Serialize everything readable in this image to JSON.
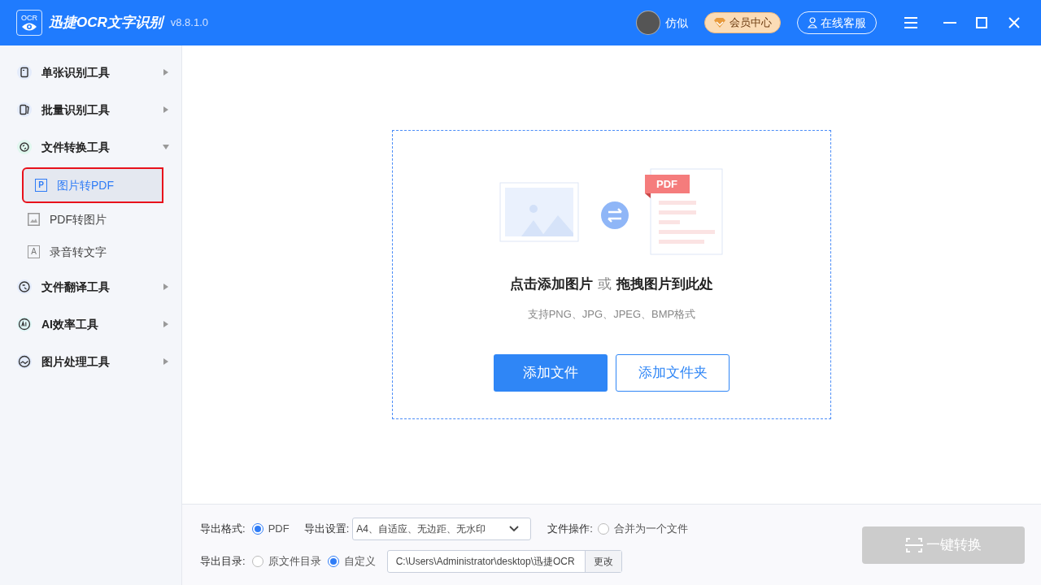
{
  "app": {
    "logo_text": "OCR",
    "title": "迅捷OCR文字识别",
    "version": "v8.8.1.0"
  },
  "header": {
    "username": "仿似",
    "vip_label": "会员中心",
    "service_label": "在线客服"
  },
  "sidebar": {
    "groups": [
      {
        "label": "单张识别工具",
        "kind": "single",
        "expanded": false
      },
      {
        "label": "批量识别工具",
        "kind": "batch",
        "expanded": false
      },
      {
        "label": "文件转换工具",
        "kind": "convert",
        "expanded": true,
        "children": [
          {
            "label": "图片转PDF",
            "icon": "P",
            "kind": "letter",
            "selected": true
          },
          {
            "label": "PDF转图片",
            "kind": "image",
            "selected": false
          },
          {
            "label": "录音转文字",
            "icon": "A",
            "kind": "letter",
            "selected": false
          }
        ]
      },
      {
        "label": "文件翻译工具",
        "kind": "translate",
        "expanded": false
      },
      {
        "label": "AI效率工具",
        "kind": "ai",
        "expanded": false
      },
      {
        "label": "图片处理工具",
        "kind": "picture",
        "expanded": false
      }
    ]
  },
  "drop_zone": {
    "pdf_tag": "PDF",
    "title_a": "点击添加图片",
    "or": "或",
    "title_b": "拖拽图片到此处",
    "hint": "支持PNG、JPG、JPEG、BMP格式",
    "buttons": [
      {
        "label": "添加文件",
        "primary": true
      },
      {
        "label": "添加文件夹",
        "primary": false
      }
    ]
  },
  "bottom": {
    "format_label": "导出格式:",
    "format_option": {
      "label": "PDF",
      "selected": true
    },
    "settings_label": "导出设置:",
    "settings_value": "A4、自适应、无边距、无水印",
    "ops_label": "文件操作:",
    "merge_option": {
      "label": "合并为一个文件",
      "selected": false
    },
    "dir_label": "导出目录:",
    "dir_options": [
      {
        "label": "原文件目录",
        "selected": false
      },
      {
        "label": "自定义",
        "selected": true
      }
    ],
    "path": "C:\\Users\\Administrator\\desktop\\迅捷OCR",
    "change_label": "更改",
    "convert_label": "一键转换",
    "convert_disabled": true
  }
}
